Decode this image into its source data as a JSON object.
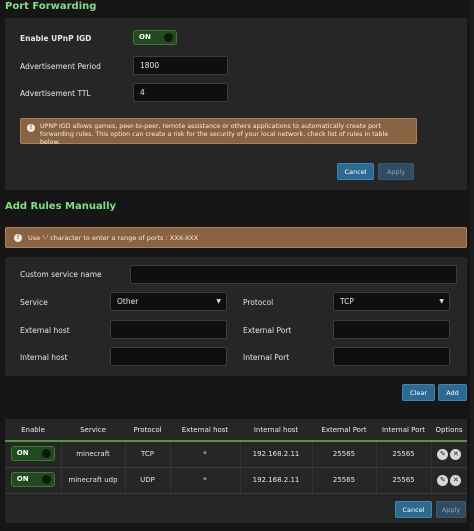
{
  "port_forwarding": {
    "title": "Port Forwarding",
    "upnp_label": "Enable UPnP IGD",
    "upnp_toggle": "ON",
    "adv_period_label": "Advertisement Period",
    "adv_period_value": "1800",
    "adv_ttl_label": "Advertisement TTL",
    "adv_ttl_value": "4",
    "warning": "UPNP IGD allows games, peer-to-peer, remote assistance or others applications to automatically create port forwarding rules. This option can create a risk for the security of your local network, check list of rules in table below.",
    "cancel_label": "Cancel",
    "apply_label": "Apply"
  },
  "add_rules": {
    "title": "Add Rules Manually",
    "hint": "Use '-' character to enter a range of ports : XXX-XXX",
    "custom_service_label": "Custom service name",
    "custom_service_value": "",
    "service_label": "Service",
    "service_value": "Other",
    "protocol_label": "Protocol",
    "protocol_value": "TCP",
    "external_host_label": "External host",
    "external_host_value": "",
    "external_port_label": "External Port",
    "external_port_value": "",
    "internal_host_label": "Internal host",
    "internal_host_value": "",
    "internal_port_label": "Internal Port",
    "internal_port_value": "",
    "clear_label": "Clear",
    "add_label": "Add"
  },
  "rules_table": {
    "headers": [
      "Enable",
      "Service",
      "Protocol",
      "External host",
      "Internal host",
      "External Port",
      "Internal Port",
      "Options"
    ],
    "rows": [
      {
        "enable": "ON",
        "service": "minecraft",
        "protocol": "TCP",
        "external_host": "*",
        "internal_host": "192.168.2.11",
        "external_port": "25565",
        "internal_port": "25565"
      },
      {
        "enable": "ON",
        "service": "minecraft udp",
        "protocol": "UDP",
        "external_host": "*",
        "internal_host": "192.168.2.11",
        "external_port": "25565",
        "internal_port": "25565"
      }
    ],
    "cancel_label": "Cancel",
    "apply_label": "Apply"
  },
  "colors": {
    "title_green": "#7fe07f",
    "toggle_on": "#214a1e",
    "warning_bg": "#8a6442",
    "primary_button": "#2d6a91"
  },
  "icons": {
    "warning": "info-circle-icon",
    "edit": "pencil-icon",
    "delete": "trash-icon",
    "caret": "caret-down-icon"
  }
}
